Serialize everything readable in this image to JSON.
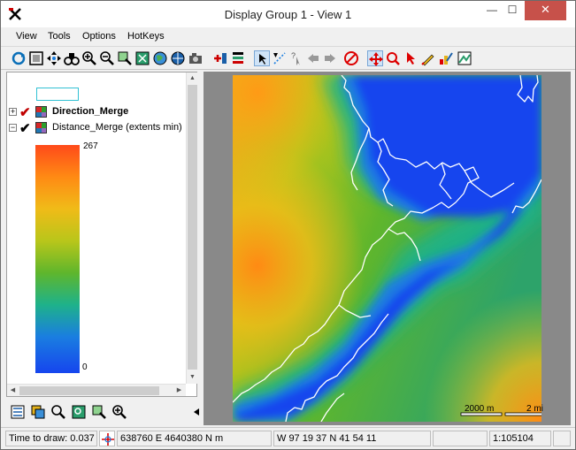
{
  "window": {
    "title": "Display Group 1 - View 1",
    "minimize": "—",
    "maximize": "☐",
    "close": "✕"
  },
  "menu": [
    "View",
    "Tools",
    "Options",
    "HotKeys"
  ],
  "toolbar": {
    "icons": [
      "redraw-icon",
      "full-view-icon",
      "pan-icon",
      "binoculars-icon",
      "zoom-in-icon",
      "zoom-out-icon",
      "zoom-box-icon",
      "zoom-extents-icon",
      "globe-icon",
      "globe-2-icon",
      "snapshot-icon",
      "add-layer-icon",
      "layer-list-icon",
      "select-icon",
      "measure-icon",
      "help-pointer-icon",
      "back-icon",
      "forward-icon",
      "cancel-draw-icon",
      "move-tool-icon",
      "zoom-tool-icon",
      "pointer-tool-icon",
      "sketch-tool-icon",
      "edit-tool-icon",
      "view-toggle-icon"
    ]
  },
  "layers": [
    {
      "name": "Direction_Merge",
      "expander": "+",
      "checked": true,
      "check_color": "#c00000",
      "bold": true
    },
    {
      "name": "Distance_Merge (extents min)",
      "expander": "−",
      "checked": true,
      "check_color": "#000000",
      "bold": false
    }
  ],
  "legend": {
    "max_label": "267",
    "min_label": "0",
    "colors": [
      "#ff4a1a",
      "#ff8a14",
      "#f0bb18",
      "#b9c61a",
      "#5fb62c",
      "#1eb28a",
      "#1a7ee0",
      "#1645ee"
    ]
  },
  "scalebar": {
    "metric": "2000 m",
    "imperial": "2 mi"
  },
  "status": {
    "time_to_draw": "Time to draw: 0.037",
    "coords_utm": "638760 E  4640380 N m",
    "coords_latlon": "W 97 19 37  N 41 54 11",
    "scale": "1:105104"
  }
}
